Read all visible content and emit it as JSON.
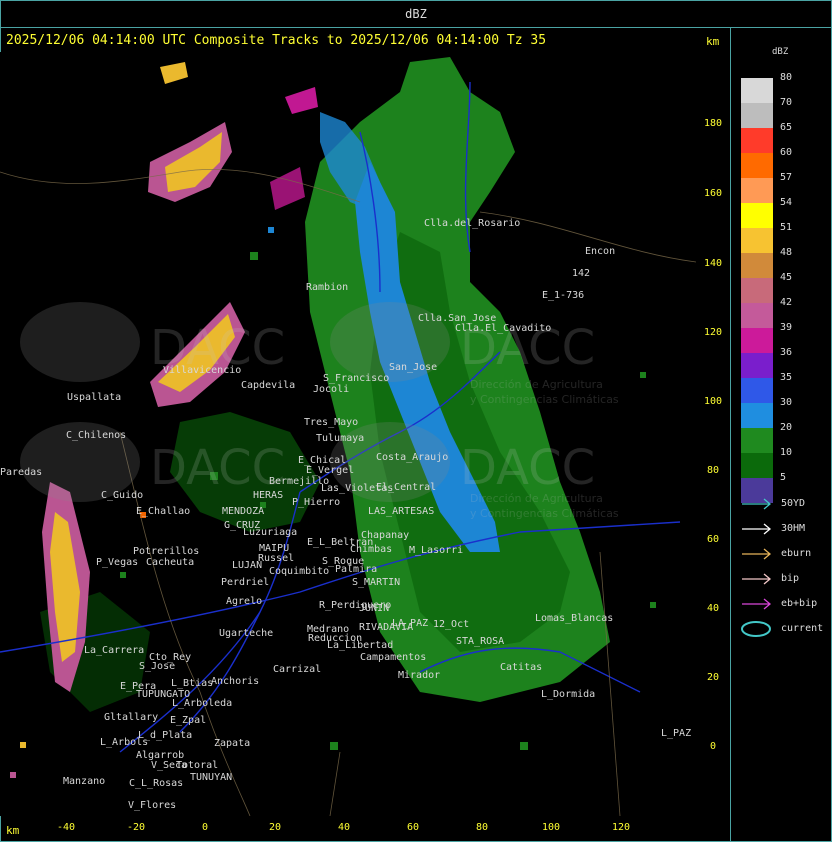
{
  "title": "dBZ",
  "header": "2025/12/06 04:14:00 UTC Composite Tracks to 2025/12/06 04:14:00 Tz 35",
  "axis_unit": "km",
  "y_ticks": [
    "180",
    "160",
    "140",
    "120",
    "100",
    "80",
    "60",
    "40",
    "20",
    "0"
  ],
  "x_ticks": [
    "-40",
    "-20",
    "0",
    "20",
    "40",
    "60",
    "80",
    "100",
    "120"
  ],
  "watermark": {
    "brand": "DACC",
    "line1": "Dirección de Agricultura",
    "line2": "y Contingencias Climáticas"
  },
  "places": [
    {
      "name": "Clla.del_Rosario"
    },
    {
      "name": "Encon"
    },
    {
      "name": "142"
    },
    {
      "name": "E_1-736"
    },
    {
      "name": "Rambion"
    },
    {
      "name": "Clla.San_Jose"
    },
    {
      "name": "Clla.El_Cavadito"
    },
    {
      "name": "Uspallata"
    },
    {
      "name": "Villavicencio"
    },
    {
      "name": "Capdevila"
    },
    {
      "name": "S_Francisco"
    },
    {
      "name": "Jocoli"
    },
    {
      "name": "San_Jose"
    },
    {
      "name": "C_Chilenos"
    },
    {
      "name": "Tres_Mayo"
    },
    {
      "name": "Tulumaya"
    },
    {
      "name": "E_Chical"
    },
    {
      "name": "E_Vergel"
    },
    {
      "name": "Costa_Araujo"
    },
    {
      "name": "Paredas"
    },
    {
      "name": "Bermejillo"
    },
    {
      "name": "Las_Violetas"
    },
    {
      "name": "El_Central"
    },
    {
      "name": "C_Guido"
    },
    {
      "name": "HERAS"
    },
    {
      "name": "P_Hierro"
    },
    {
      "name": "E_Challao"
    },
    {
      "name": "MENDOZA"
    },
    {
      "name": "LAS_ARTESAS"
    },
    {
      "name": "G_CRUZ"
    },
    {
      "name": "Luzuriaga"
    },
    {
      "name": "E_L_Beltran"
    },
    {
      "name": "Chapanay"
    },
    {
      "name": "Potrerillos"
    },
    {
      "name": "Cacheuta"
    },
    {
      "name": "MAIPU"
    },
    {
      "name": "Russel"
    },
    {
      "name": "Chimbas"
    },
    {
      "name": "M_Lasorri"
    },
    {
      "name": "P_Vegas"
    },
    {
      "name": "LUJAN"
    },
    {
      "name": "Coquimbito"
    },
    {
      "name": "S_Roque"
    },
    {
      "name": "Palmira"
    },
    {
      "name": "Perdriel"
    },
    {
      "name": "S_MARTIN"
    },
    {
      "name": "Agrelo"
    },
    {
      "name": "R_Perdiguero"
    },
    {
      "name": "JUNIN"
    },
    {
      "name": "Ugarteche"
    },
    {
      "name": "Medrano"
    },
    {
      "name": "RIVADAVIA"
    },
    {
      "name": "12_Oct"
    },
    {
      "name": "Reduccion"
    },
    {
      "name": "La_Libertad"
    },
    {
      "name": "LA_PAZ"
    },
    {
      "name": "STA_ROSA"
    },
    {
      "name": "La_Carrera"
    },
    {
      "name": "Cto_Rey"
    },
    {
      "name": "S_Jose"
    },
    {
      "name": "Carrizal"
    },
    {
      "name": "Campamentos"
    },
    {
      "name": "Catitas"
    },
    {
      "name": "E_Pera"
    },
    {
      "name": "L_Btias"
    },
    {
      "name": "Anchoris"
    },
    {
      "name": "TUPUNGATO"
    },
    {
      "name": "Mirador"
    },
    {
      "name": "L_Dormida"
    },
    {
      "name": "L_Arboleda"
    },
    {
      "name": "Gltallary"
    },
    {
      "name": "E_Zpal"
    },
    {
      "name": "L_d_Plata"
    },
    {
      "name": "L_Arbols"
    },
    {
      "name": "Zapata"
    },
    {
      "name": "Algarrob"
    },
    {
      "name": "V_Seca"
    },
    {
      "name": "Totoral"
    },
    {
      "name": "TUNUYAN"
    },
    {
      "name": "Manzano"
    },
    {
      "name": "C_L_Rosas"
    },
    {
      "name": "V_Flores"
    },
    {
      "name": "L_PAZ"
    },
    {
      "name": "Lomas_Blancas"
    }
  ],
  "legend": {
    "title": "dBZ",
    "scale": [
      {
        "label": "80",
        "color": "#d8d8d8"
      },
      {
        "label": "70",
        "color": "#bdbdbd"
      },
      {
        "label": "65",
        "color": "#ff3b2a"
      },
      {
        "label": "60",
        "color": "#ff6a00"
      },
      {
        "label": "57",
        "color": "#ff9a55"
      },
      {
        "label": "54",
        "color": "#ffff00"
      },
      {
        "label": "51",
        "color": "#f7c331"
      },
      {
        "label": "48",
        "color": "#d18a3a"
      },
      {
        "label": "45",
        "color": "#c86a7a"
      },
      {
        "label": "42",
        "color": "#c45a9a"
      },
      {
        "label": "39",
        "color": "#cc1a9a"
      },
      {
        "label": "36",
        "color": "#7a1ecc"
      },
      {
        "label": "35",
        "color": "#2f58e8"
      },
      {
        "label": "30",
        "color": "#1f8ee0"
      },
      {
        "label": "20",
        "color": "#1f8a1f"
      },
      {
        "label": "10",
        "color": "#0b6a0b"
      },
      {
        "label": "5",
        "color": "#4b3a9a"
      }
    ],
    "tracks": [
      {
        "label": "50YD",
        "color": "#43c8c8",
        "symbol": "arrow"
      },
      {
        "label": "30HM",
        "color": "#ffffff",
        "symbol": "arrow"
      },
      {
        "label": "eburn",
        "color": "#e6b45a",
        "symbol": "arrow"
      },
      {
        "label": "bip",
        "color": "#f2c8c8",
        "symbol": "arrow"
      },
      {
        "label": "eb+bip",
        "color": "#d946d9",
        "symbol": "arrow"
      },
      {
        "label": "current",
        "color": "#43c8c8",
        "symbol": "ellipse"
      }
    ]
  }
}
